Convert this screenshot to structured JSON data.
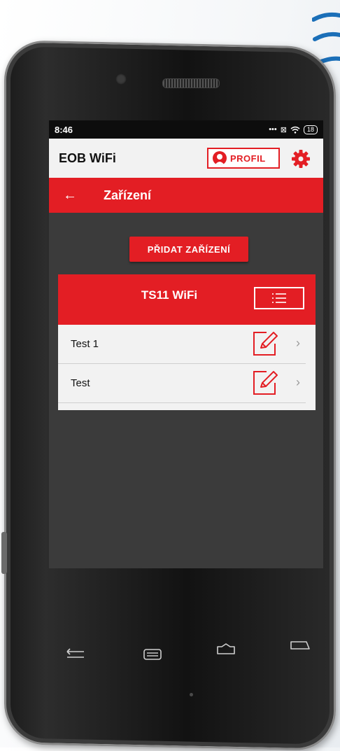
{
  "status": {
    "time": "8:46",
    "battery": "18"
  },
  "app": {
    "title": "EOB WiFi",
    "profile_label": "PROFIL"
  },
  "page": {
    "title": "Zařízení",
    "add_device_label": "PŘIDAT ZAŘÍZENÍ"
  },
  "device_card": {
    "title": "TS11 WiFi",
    "items": [
      {
        "label": "Test 1"
      },
      {
        "label": "Test"
      }
    ]
  },
  "colors": {
    "accent": "#e31e24",
    "bar": "#f2f2f2",
    "screen_bg": "#3b3b3b"
  },
  "icons": {
    "back": "arrow-left-icon",
    "profile": "user-icon",
    "settings": "gear-icon",
    "menu": "list-icon",
    "edit": "pencil-icon",
    "chevron": "chevron-right-icon"
  }
}
